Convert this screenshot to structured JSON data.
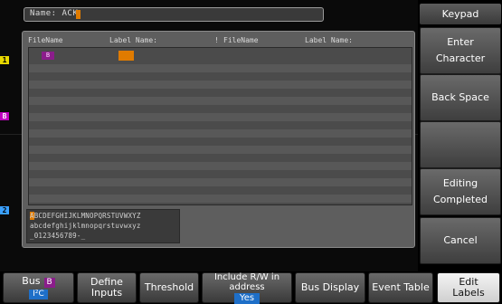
{
  "name_field": {
    "label": "Name: ",
    "value": "ACK"
  },
  "table_headers": {
    "file_name_1": "FileName",
    "label_name_1": "Label Name:",
    "file_name_2": "FileName",
    "label_name_2": "Label Name:",
    "separator": "!"
  },
  "rows": [
    {
      "file_badge": "B"
    }
  ],
  "keyboard": {
    "line1": "ABCDEFGHIJKLMNOPQRSTUVWXYZ",
    "line2": "abcdefghijklmnopqrstuvwxyz",
    "line3": "_0123456789-_"
  },
  "side_menu": {
    "title": "Keypad",
    "enter_character": "Enter Character",
    "back_space": "Back Space",
    "editing_completed": "Editing Completed",
    "cancel": "Cancel"
  },
  "bottom_menu": {
    "bus_label": "Bus",
    "bus_value": "B",
    "bus_type": "I²C",
    "define_inputs": "Define Inputs",
    "threshold": "Threshold",
    "include_rw": "Include R/W in address",
    "include_rw_value": "Yes",
    "bus_display": "Bus Display",
    "event_table": "Event Table",
    "edit_labels": "Edit Labels"
  },
  "channel_markers": [
    "1",
    "B",
    "2"
  ],
  "colors": {
    "accent_orange": "#e07b00",
    "bus_purple": "#8b1d8b",
    "yes_blue": "#1e6fc8",
    "ch1_yellow": "#e8d800",
    "ch2_blue": "#3aa0ff"
  }
}
